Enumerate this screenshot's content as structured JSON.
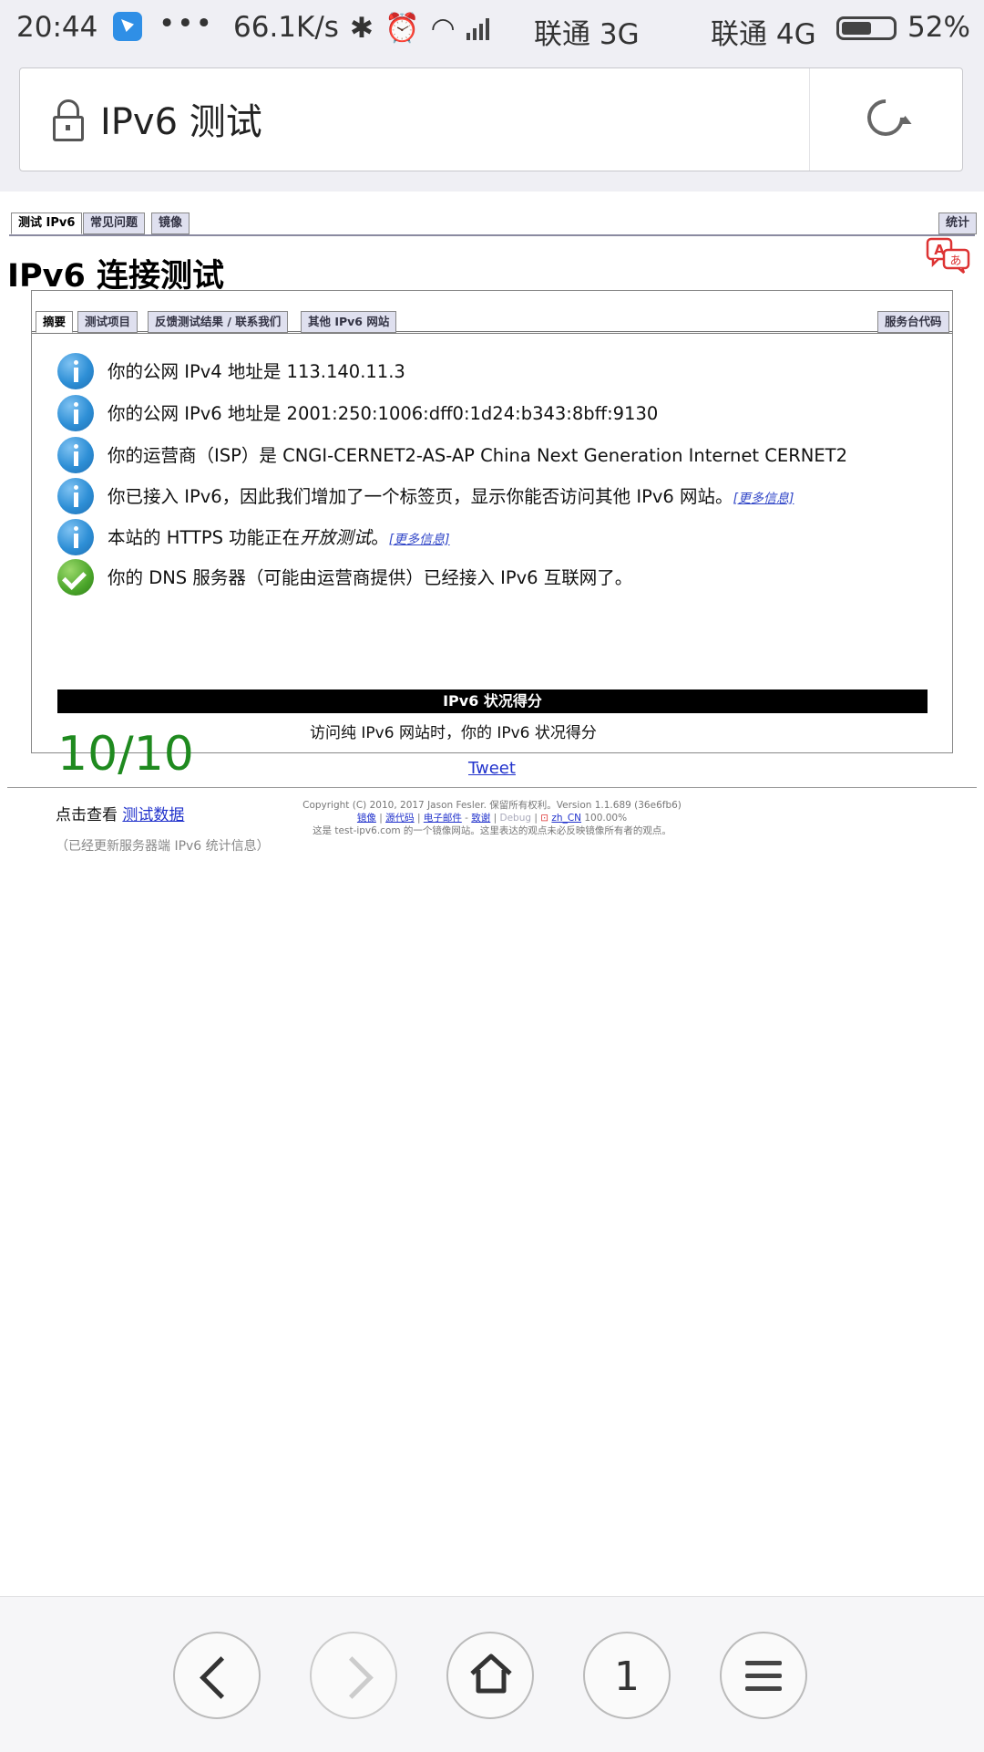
{
  "status_bar": {
    "time": "20:44",
    "dots": "•••",
    "speed": "66.1K/s",
    "carrier1": "联通 3G",
    "carrier2": "联通 4G",
    "battery_pct": "52%",
    "battery_level": 0.52,
    "icons": [
      "app-icon",
      "bluetooth-icon",
      "alarm-icon",
      "wifi-icon",
      "signal-icon",
      "battery-icon"
    ]
  },
  "address_bar": {
    "title": "IPv6 测试"
  },
  "top_tabs": {
    "test": "测试 IPv6",
    "faq": "常见问题",
    "mirror": "镜像",
    "stats": "统计"
  },
  "heading": "IPv6 连接测试",
  "inner_tabs": {
    "summary": "摘要",
    "tests": "测试项目",
    "feedback": "反馈测试结果 / 联系我们",
    "other": "其他 IPv6 网站",
    "helpdesk": "服务台代码"
  },
  "info": {
    "ipv4": "你的公网 IPv4 地址是 113.140.11.3",
    "ipv6": "你的公网 IPv6 地址是 2001:250:1006:dff0:1d24:b343:8bff:9130",
    "isp": "你的运营商（ISP）是 CNGI-CERNET2-AS-AP China Next Generation Internet CERNET2",
    "tab_added": "你已接入 IPv6，因此我们增加了一个标签页，显示你能否访问其他 IPv6 网站。",
    "https_prefix": "本站的 HTTPS 功能正在",
    "https_italic": "开放测试",
    "https_suffix": "。",
    "dns": "你的 DNS 服务器（可能由运营商提供）已经接入 IPv6 互联网了。",
    "more_info": "[更多信息]"
  },
  "score": {
    "bar_title": "IPv6 状况得分",
    "description": "访问纯 IPv6 网站时，你的 IPv6 状况得分",
    "value": "10/10",
    "view_prefix": "点击查看",
    "view_link": "测试数据",
    "note": "（已经更新服务器端 IPv6 统计信息）"
  },
  "tweet": "Tweet",
  "footer": {
    "copyright": "Copyright (C) 2010, 2017 Jason Fesler. 保留所有权利。Version 1.1.689 (36e6fb6)",
    "mirror": "镜像",
    "source": "源代码",
    "email": "电子邮件",
    "sep": " - ",
    "thanks": "致谢",
    "debug": "Debug",
    "locale": "zh_CN",
    "percent": "100.00%",
    "disclaimer": "这是 test-ipv6.com 的一个镜像网站。这里表达的观点未必反映镜像所有者的观点。"
  },
  "bottom_nav": {
    "tab_count": "1"
  }
}
